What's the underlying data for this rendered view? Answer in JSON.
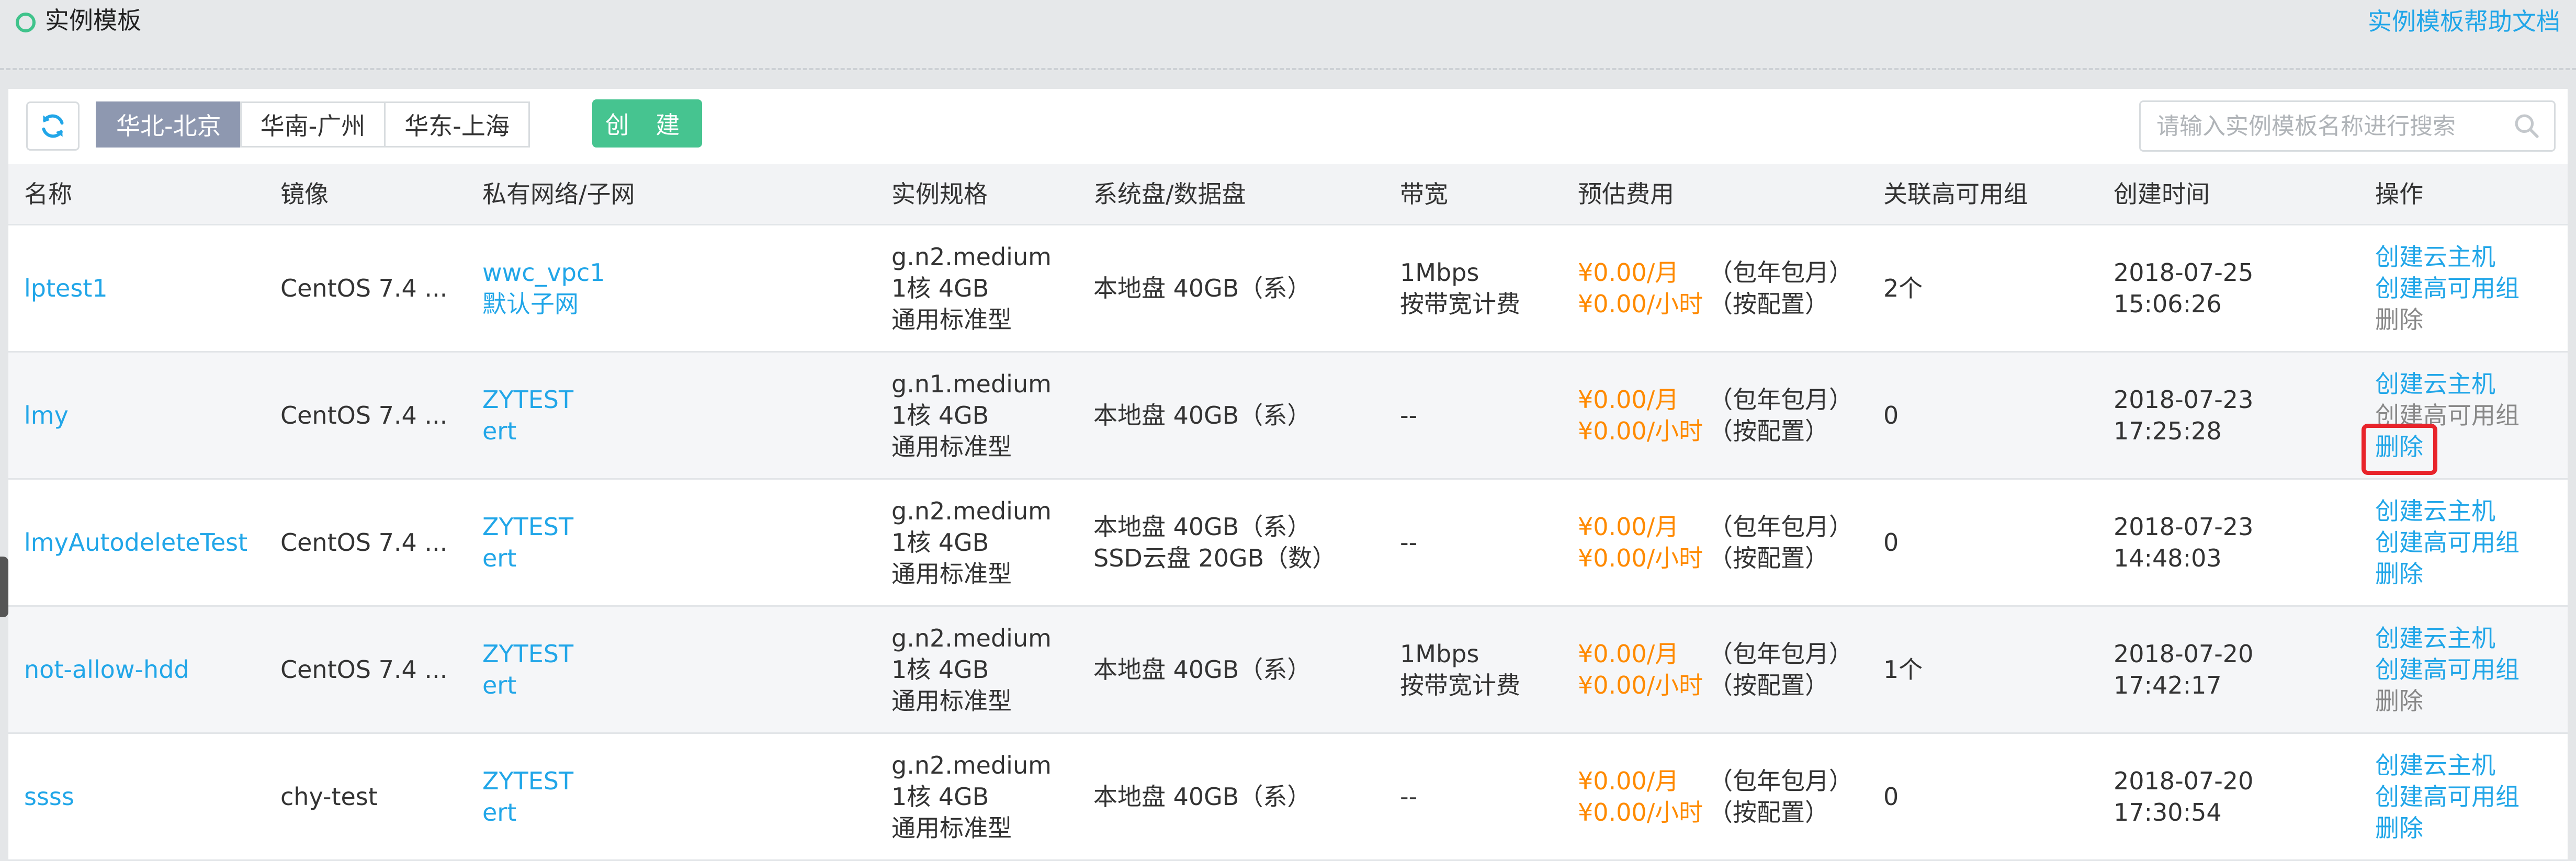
{
  "header": {
    "title": "实例模板",
    "help_link": "实例模板帮助文档"
  },
  "toolbar": {
    "refresh_icon": "refresh-icon",
    "regions": [
      "华北-北京",
      "华南-广州",
      "华东-上海"
    ],
    "active_region": "华北-北京",
    "create_label": "创 建",
    "search_placeholder": "请输入实例模板名称进行搜索",
    "search_value": "",
    "search_icon": "search-icon"
  },
  "table": {
    "columns": [
      "名称",
      "镜像",
      "私有网络/子网",
      "实例规格",
      "系统盘/数据盘",
      "带宽",
      "预估费用",
      "关联高可用组",
      "创建时间",
      "操作"
    ],
    "rows": [
      {
        "name": "lptest1",
        "image": "CentOS 7.4 ...",
        "vpc": "wwc_vpc1",
        "subnet": "默认子网",
        "spec": [
          "g.n2.medium",
          "1核 4GB",
          "通用标准型"
        ],
        "disks": [
          "本地盘 40GB（系）"
        ],
        "bandwidth": [
          "1Mbps",
          "按带宽计费"
        ],
        "fees": [
          {
            "price": "¥0.00/月",
            "mode": "（包年包月）"
          },
          {
            "price": "¥0.00/小时",
            "mode": "（按配置）"
          }
        ],
        "ha_group": "2个",
        "created": [
          "2018-07-25",
          "15:06:26"
        ],
        "actions": [
          {
            "label": "创建云主机",
            "enabled": true
          },
          {
            "label": "创建高可用组",
            "enabled": true
          },
          {
            "label": "删除",
            "enabled": false
          }
        ]
      },
      {
        "name": "lmy",
        "image": "CentOS 7.4 ...",
        "vpc": "ZYTEST",
        "subnet": "ert",
        "spec": [
          "g.n1.medium",
          "1核 4GB",
          "通用标准型"
        ],
        "disks": [
          "本地盘 40GB（系）"
        ],
        "bandwidth": [
          "--"
        ],
        "fees": [
          {
            "price": "¥0.00/月",
            "mode": "（包年包月）"
          },
          {
            "price": "¥0.00/小时",
            "mode": "（按配置）"
          }
        ],
        "ha_group": "0",
        "created": [
          "2018-07-23",
          "17:25:28"
        ],
        "actions": [
          {
            "label": "创建云主机",
            "enabled": true
          },
          {
            "label": "创建高可用组",
            "enabled": false
          },
          {
            "label": "删除",
            "enabled": true
          }
        ]
      },
      {
        "name": "lmyAutodeleteTest",
        "image": "CentOS 7.4 ...",
        "vpc": "ZYTEST",
        "subnet": "ert",
        "spec": [
          "g.n2.medium",
          "1核 4GB",
          "通用标准型"
        ],
        "disks": [
          "本地盘 40GB（系）",
          "SSD云盘 20GB（数）"
        ],
        "bandwidth": [
          "--"
        ],
        "fees": [
          {
            "price": "¥0.00/月",
            "mode": "（包年包月）"
          },
          {
            "price": "¥0.00/小时",
            "mode": "（按配置）"
          }
        ],
        "ha_group": "0",
        "created": [
          "2018-07-23",
          "14:48:03"
        ],
        "actions": [
          {
            "label": "创建云主机",
            "enabled": true
          },
          {
            "label": "创建高可用组",
            "enabled": true
          },
          {
            "label": "删除",
            "enabled": true
          }
        ]
      },
      {
        "name": "not-allow-hdd",
        "image": "CentOS 7.4 ...",
        "vpc": "ZYTEST",
        "subnet": "ert",
        "spec": [
          "g.n2.medium",
          "1核 4GB",
          "通用标准型"
        ],
        "disks": [
          "本地盘 40GB（系）"
        ],
        "bandwidth": [
          "1Mbps",
          "按带宽计费"
        ],
        "fees": [
          {
            "price": "¥0.00/月",
            "mode": "（包年包月）"
          },
          {
            "price": "¥0.00/小时",
            "mode": "（按配置）"
          }
        ],
        "ha_group": "1个",
        "created": [
          "2018-07-20",
          "17:42:17"
        ],
        "actions": [
          {
            "label": "创建云主机",
            "enabled": true
          },
          {
            "label": "创建高可用组",
            "enabled": true
          },
          {
            "label": "删除",
            "enabled": false
          }
        ]
      },
      {
        "name": "ssss",
        "image": "chy-test",
        "vpc": "ZYTEST",
        "subnet": "ert",
        "spec": [
          "g.n2.medium",
          "1核 4GB",
          "通用标准型"
        ],
        "disks": [
          "本地盘 40GB（系）"
        ],
        "bandwidth": [
          "--"
        ],
        "fees": [
          {
            "price": "¥0.00/月",
            "mode": "（包年包月）"
          },
          {
            "price": "¥0.00/小时",
            "mode": "（按配置）"
          }
        ],
        "ha_group": "0",
        "created": [
          "2018-07-20",
          "17:30:54"
        ],
        "actions": [
          {
            "label": "创建云主机",
            "enabled": true
          },
          {
            "label": "创建高可用组",
            "enabled": true
          },
          {
            "label": "删除",
            "enabled": true
          }
        ]
      }
    ]
  },
  "colors": {
    "accent": "#21a6e8",
    "create_button": "#46c490",
    "price": "#ff8a00",
    "active_tab": "#8e98b0",
    "status_dot": "#3fc38b",
    "highlight": "#e8242b",
    "disabled_action": "#888888"
  }
}
